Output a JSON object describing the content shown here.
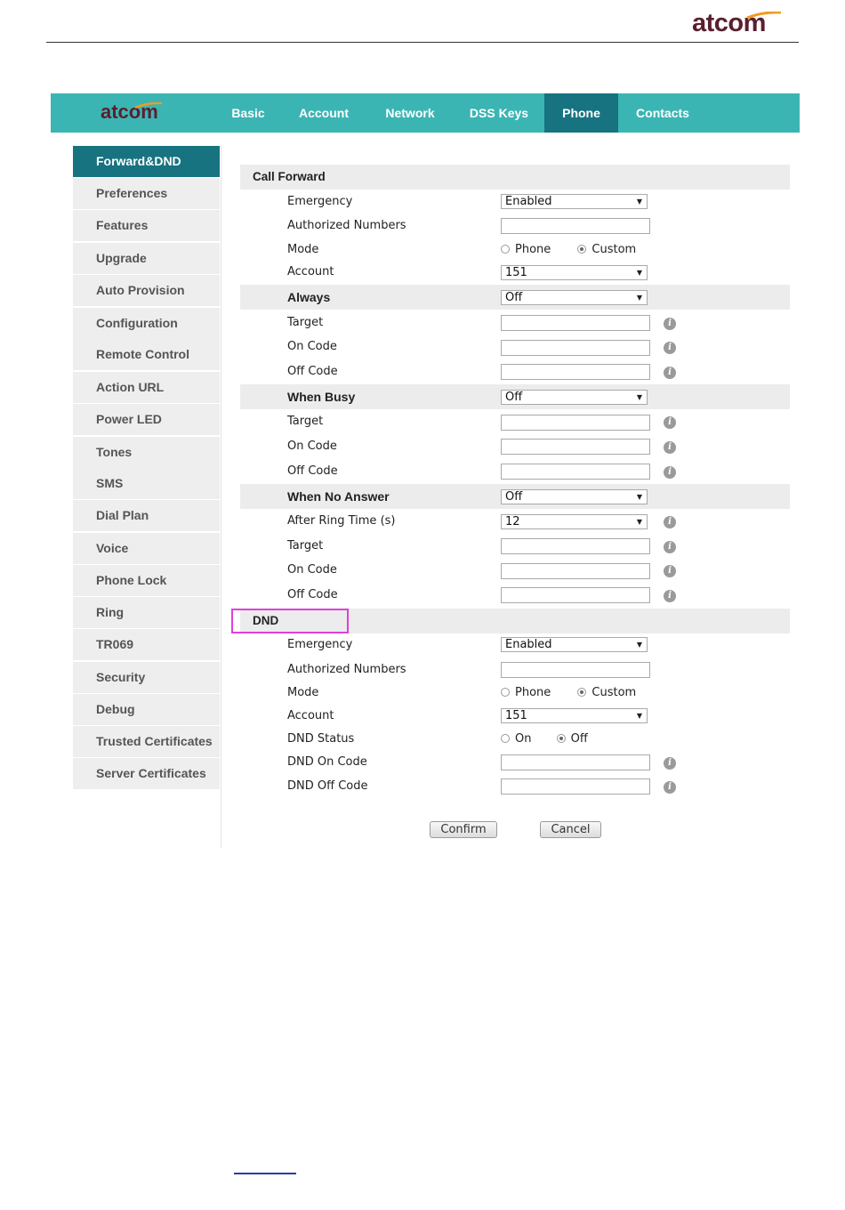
{
  "brand": {
    "name": "atcom",
    "accent": "#f29a1f",
    "brand_color": "#5a1f2e"
  },
  "nav": {
    "color": "#3bb5b3",
    "active_color": "#177380",
    "items": [
      {
        "label": "Basic"
      },
      {
        "label": "Account"
      },
      {
        "label": "Network"
      },
      {
        "label": "DSS Keys"
      },
      {
        "label": "Phone",
        "active": true
      },
      {
        "label": "Contacts"
      }
    ]
  },
  "sidebar": {
    "items": [
      {
        "label": "Forward&DND",
        "active": true
      },
      {
        "label": "Preferences"
      },
      {
        "label": "Features"
      },
      {
        "label": "Upgrade"
      },
      {
        "label": "Auto Provision"
      },
      {
        "label": "Configuration"
      },
      {
        "label": "Remote Control"
      },
      {
        "label": "Action URL"
      },
      {
        "label": "Power LED"
      },
      {
        "label": "Tones"
      },
      {
        "label": "SMS"
      },
      {
        "label": "Dial Plan"
      },
      {
        "label": "Voice"
      },
      {
        "label": "Phone Lock"
      },
      {
        "label": "Ring"
      },
      {
        "label": "TR069"
      },
      {
        "label": "Security"
      },
      {
        "label": "Debug"
      },
      {
        "label": "Trusted Certificates"
      },
      {
        "label": "Server Certificates"
      }
    ]
  },
  "call_forward": {
    "title": "Call Forward",
    "emergency": {
      "label": "Emergency",
      "value": "Enabled"
    },
    "authorized_numbers": {
      "label": "Authorized Numbers",
      "value": ""
    },
    "mode": {
      "label": "Mode",
      "options": [
        "Phone",
        "Custom"
      ],
      "selected": "Custom"
    },
    "account": {
      "label": "Account",
      "value": "151"
    },
    "always": {
      "label": "Always",
      "value": "Off",
      "target": {
        "label": "Target"
      },
      "on_code": {
        "label": "On Code"
      },
      "off_code": {
        "label": "Off Code"
      }
    },
    "when_busy": {
      "label": "When Busy",
      "value": "Off",
      "target": {
        "label": "Target"
      },
      "on_code": {
        "label": "On Code"
      },
      "off_code": {
        "label": "Off Code"
      }
    },
    "when_no_answer": {
      "label": "When No Answer",
      "value": "Off",
      "ring_time": {
        "label": "After Ring Time (s)",
        "value": "12"
      },
      "target": {
        "label": "Target"
      },
      "on_code": {
        "label": "On Code"
      },
      "off_code": {
        "label": "Off Code"
      }
    }
  },
  "dnd": {
    "title": "DND",
    "emergency": {
      "label": "Emergency",
      "value": "Enabled"
    },
    "authorized_numbers": {
      "label": "Authorized Numbers"
    },
    "mode": {
      "label": "Mode",
      "options": [
        "Phone",
        "Custom"
      ],
      "selected": "Custom"
    },
    "account": {
      "label": "Account",
      "value": "151"
    },
    "status": {
      "label": "DND Status",
      "options": [
        "On",
        "Off"
      ],
      "selected": "Off"
    },
    "on_code": {
      "label": "DND On Code"
    },
    "off_code": {
      "label": "DND Off Code"
    }
  },
  "buttons": {
    "confirm": "Confirm",
    "cancel": "Cancel"
  },
  "icons": {
    "info": "i",
    "dropdown": "▼"
  },
  "highlight_color": "#e040d8"
}
